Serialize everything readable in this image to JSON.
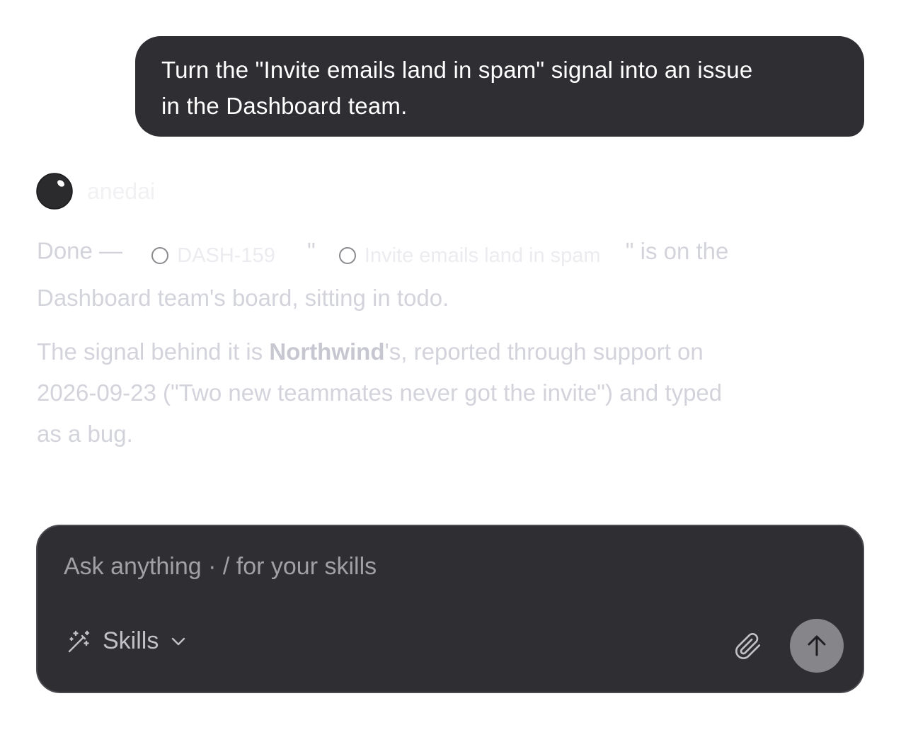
{
  "user_message": {
    "line1": "Turn the \"Invite emails land in spam\" signal into an issue",
    "line2": "in the Dashboard team."
  },
  "assistant": {
    "name": "anedai",
    "reply": {
      "done_prefix": "Done —",
      "issue_id": "DASH-159",
      "quote_open": "\"",
      "issue_title": "Invite emails land in spam",
      "quote_close": "\" is on the",
      "line2": "Dashboard team's board, sitting in todo.",
      "p2_prefix": "The signal behind it is ",
      "customer": "Northwind",
      "p2_suffix": "'s, reported through support on",
      "p2_line2": "2026-09-23 (\"Two new teammates never got the invite\") and typed",
      "p2_line3": "as a bug."
    }
  },
  "composer": {
    "placeholder": "Ask anything · / for your skills",
    "value": "",
    "skills_label": "Skills"
  },
  "icons": {
    "avatar": "anedai-logo-icon",
    "issue_status": "circle-outline-icon",
    "skills": "magic-wand-icon",
    "skills_dropdown": "chevron-down-icon",
    "attach": "paperclip-icon",
    "send": "arrow-up-icon"
  },
  "colors": {
    "bubble": "#2e2e33",
    "composer": "#2e2e33",
    "send_button": "#86868a",
    "faded_text": "#d3d3dc"
  }
}
